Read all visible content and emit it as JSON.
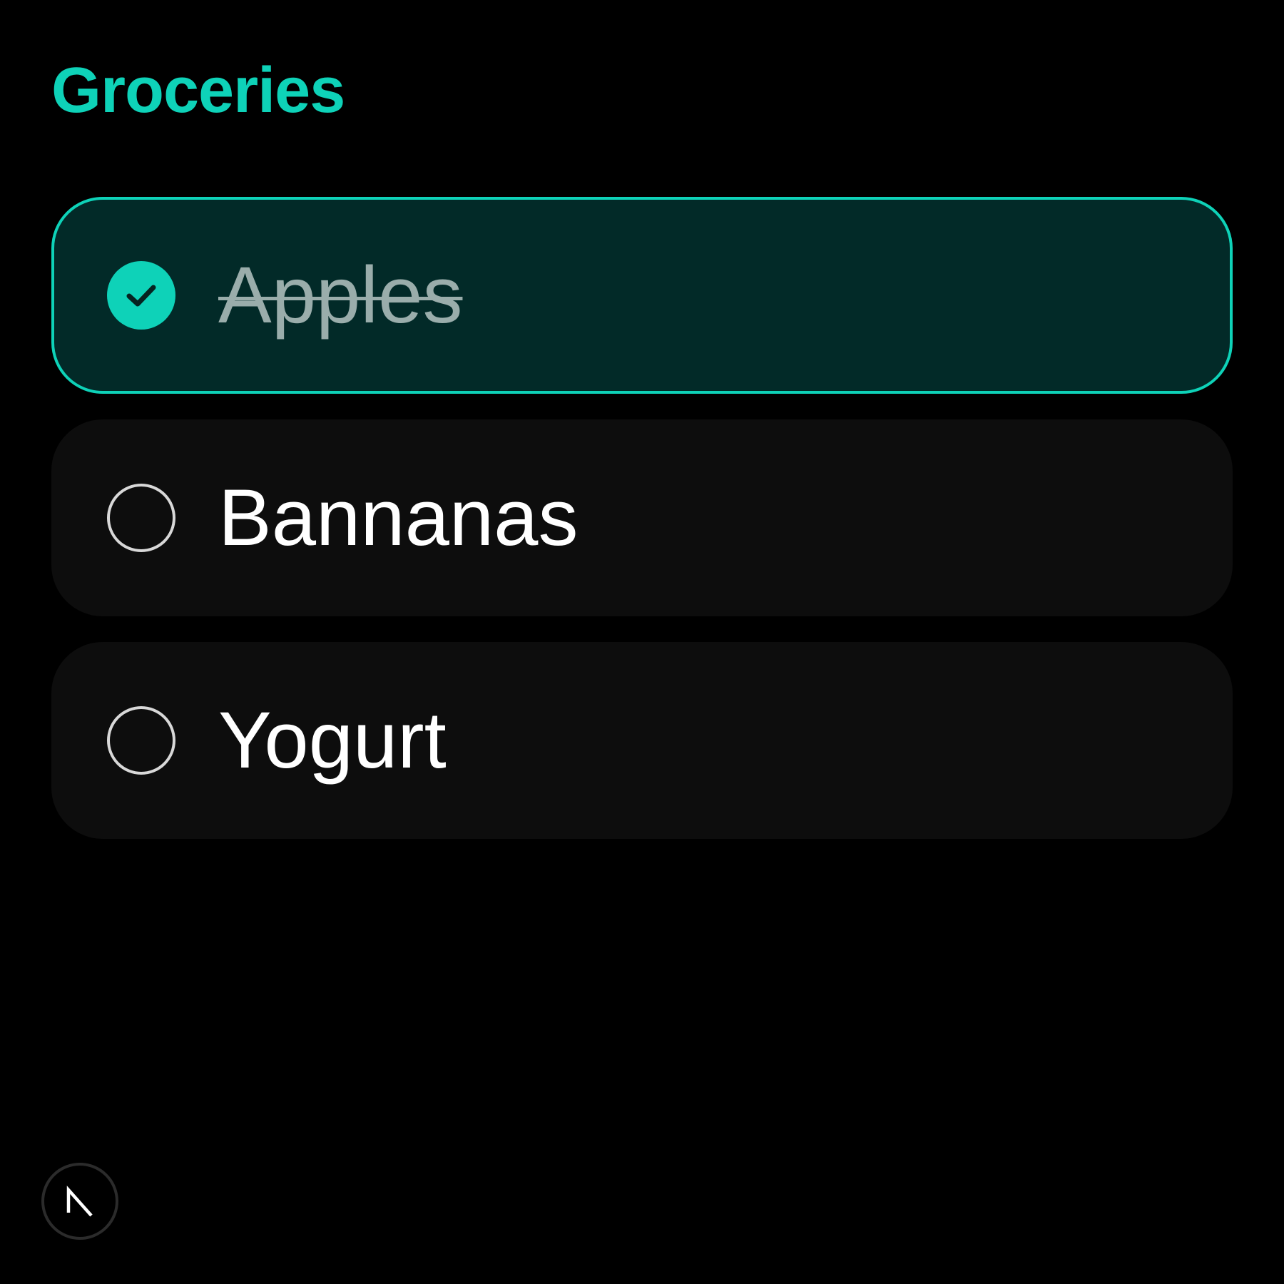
{
  "header": {
    "title": "Groceries"
  },
  "colors": {
    "accent": "#0ed2b8",
    "background": "#000000",
    "item_background": "#0d0d0d",
    "done_item_background": "#022a28",
    "done_text": "#9aadab",
    "text": "#ffffff"
  },
  "items": [
    {
      "label": "Apples",
      "done": true,
      "icon": "checked-circle-icon"
    },
    {
      "label": "Bannanas",
      "done": false,
      "icon": "empty-circle-icon"
    },
    {
      "label": "Yogurt",
      "done": false,
      "icon": "empty-circle-icon"
    }
  ],
  "badge": {
    "logo": "N",
    "icon": "nextjs-logo-icon"
  }
}
